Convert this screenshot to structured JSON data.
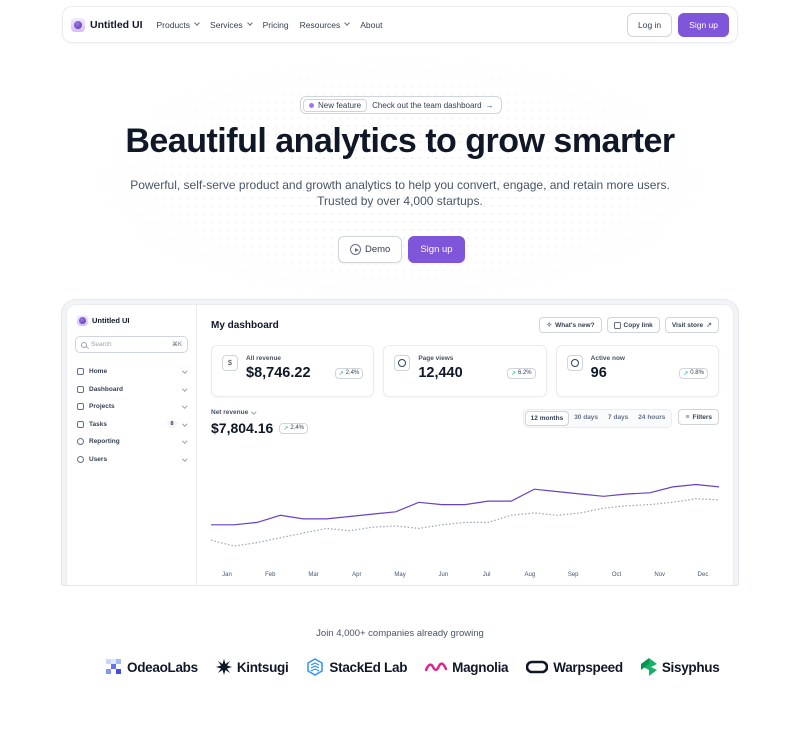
{
  "nav": {
    "brand": "Untitled UI",
    "links": [
      {
        "label": "Products",
        "has_menu": true
      },
      {
        "label": "Services",
        "has_menu": true
      },
      {
        "label": "Pricing",
        "has_menu": false
      },
      {
        "label": "Resources",
        "has_menu": true
      },
      {
        "label": "About",
        "has_menu": false
      }
    ],
    "login": "Log in",
    "signup": "Sign up"
  },
  "hero": {
    "badge_tag": "New feature",
    "badge_text": "Check out the team dashboard",
    "title": "Beautiful analytics to grow smarter",
    "subtitle_line1": "Powerful, self-serve product and growth analytics to help you convert, engage, and retain more users.",
    "subtitle_line2": "Trusted by over 4,000 startups.",
    "demo": "Demo",
    "signup": "Sign up"
  },
  "dashboard": {
    "brand": "Untitled UI",
    "search_placeholder": "Search",
    "search_kbd": "⌘K",
    "sidebar": [
      {
        "label": "Home",
        "icon": "home-icon"
      },
      {
        "label": "Dashboard",
        "icon": "bar-chart-icon"
      },
      {
        "label": "Projects",
        "icon": "layers-icon"
      },
      {
        "label": "Tasks",
        "icon": "check-square-icon",
        "count": "8"
      },
      {
        "label": "Reporting",
        "icon": "pie-chart-icon"
      },
      {
        "label": "Users",
        "icon": "users-icon"
      }
    ],
    "title": "My dashboard",
    "actions": {
      "whats_new": "What's new?",
      "copy_link": "Copy link",
      "visit_store": "Visit store"
    },
    "stats": [
      {
        "label": "All revenue",
        "value": "$8,746.22",
        "delta": "2.4%",
        "icon": "currency-dollar-icon"
      },
      {
        "label": "Page views",
        "value": "12,440",
        "delta": "6.2%",
        "icon": "eye-icon"
      },
      {
        "label": "Active now",
        "value": "96",
        "delta": "0.8%",
        "icon": "user-circle-icon"
      }
    ],
    "revenue": {
      "label": "Net revenue",
      "value": "$7,804.16",
      "delta": "2.4%"
    },
    "ranges": [
      "12 months",
      "30 days",
      "7 days",
      "24 hours"
    ],
    "active_range": "12 months",
    "filters": "Filters"
  },
  "chart_data": {
    "type": "line",
    "categories": [
      "Jan",
      "Feb",
      "Mar",
      "Apr",
      "May",
      "Jun",
      "Jul",
      "Aug",
      "Sep",
      "Oct",
      "Nov",
      "Dec"
    ],
    "series": [
      {
        "style": "solid",
        "color": "#6941c6",
        "values": [
          18,
          18,
          20,
          26,
          23,
          23,
          25,
          27,
          29,
          37,
          35,
          35,
          38,
          38,
          48,
          46,
          44,
          42,
          44,
          45,
          50,
          52,
          50
        ]
      },
      {
        "style": "dotted",
        "color": "#98a2b3",
        "values": [
          5,
          0,
          3,
          7,
          11,
          15,
          13,
          16,
          17,
          15,
          18,
          20,
          20,
          26,
          28,
          26,
          28,
          32,
          34,
          35,
          37,
          40,
          39
        ]
      }
    ],
    "ylim": [
      -10,
      60
    ]
  },
  "logos": {
    "title": "Join 4,000+ companies already growing",
    "companies": [
      "OdeaoLabs",
      "Kintsugi",
      "StackEd Lab",
      "Magnolia",
      "Warpspeed",
      "Sisyphus"
    ]
  }
}
